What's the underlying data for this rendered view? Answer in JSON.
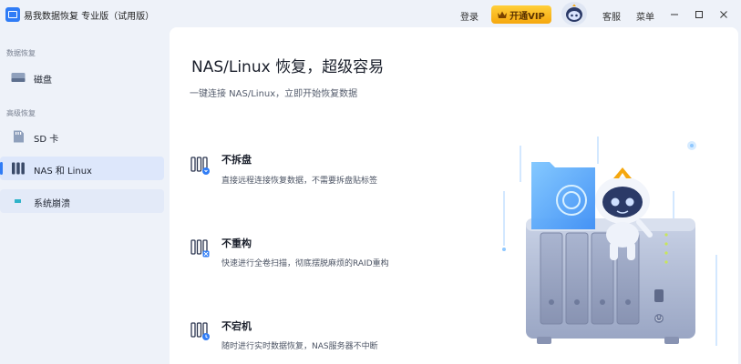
{
  "app": {
    "title": "易我数据恢复 专业版（试用版）"
  },
  "titlebar": {
    "login_label": "登录",
    "vip_label": "开通VIP",
    "service_label": "客服",
    "menu_label": "菜单"
  },
  "sidebar": {
    "section_data_recovery": "数据恢复",
    "section_advanced_recovery": "高级恢复",
    "items": [
      {
        "label": "磁盘",
        "icon": "hard-disk-icon"
      },
      {
        "label": "SD 卡",
        "icon": "sd-card-icon"
      },
      {
        "label": "NAS 和 Linux",
        "icon": "nas-icon",
        "active": true
      },
      {
        "label": "系统崩溃",
        "icon": "system-crash-icon"
      }
    ]
  },
  "main": {
    "headline": "NAS/Linux 恢复，超级容易",
    "subline": "一键连接 NAS/Linux，立即开始恢复数据",
    "features": [
      {
        "title": "不拆盘",
        "desc": "直接远程连接恢复数据，不需要拆盘贴标签",
        "icon": "no-disassembly-icon"
      },
      {
        "title": "不重构",
        "desc": "快速进行全卷扫描，彻底摆脱麻烦的RAID重构",
        "icon": "no-rebuild-icon"
      },
      {
        "title": "不宕机",
        "desc": "随时进行实时数据恢复，NAS服务器不中断",
        "icon": "no-downtime-icon"
      }
    ]
  },
  "colors": {
    "accent": "#2f7cf6",
    "vip_gold": "#f5a70e",
    "sidebar_bg": "#eef2f9",
    "active_bg": "#dde7fb"
  }
}
